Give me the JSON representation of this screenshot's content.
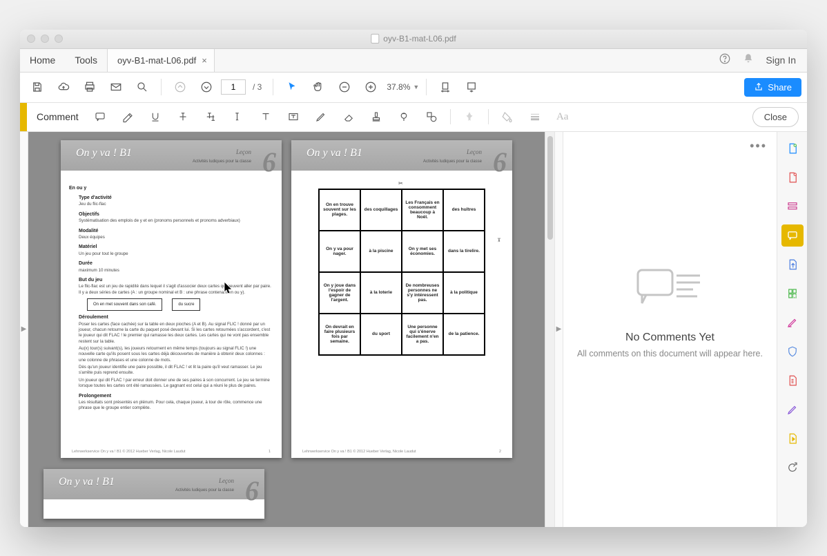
{
  "window": {
    "title": "oyv-B1-mat-L06.pdf"
  },
  "tabs": {
    "home": "Home",
    "tools": "Tools",
    "doc": "oyv-B1-mat-L06.pdf"
  },
  "header": {
    "signin": "Sign In"
  },
  "toolbar": {
    "page_current": "1",
    "page_total": "/ 3",
    "zoom": "37.8%",
    "share": "Share"
  },
  "commentbar": {
    "label": "Comment",
    "close": "Close"
  },
  "comments_panel": {
    "title": "No Comments Yet",
    "sub": "All comments on this document will appear here."
  },
  "doc": {
    "book_title": "On y va ! B1",
    "lecon": "Leçon",
    "activites": "Activités ludiques pour la classe",
    "lesson_num": "6",
    "footer_left": "Lehrwerkservice On y va ! B1 © 2012 Hueber Verlag, Nicole Laudut",
    "footer_p1": "1",
    "footer_p2": "2",
    "page1": {
      "h1": "En ou y",
      "type_h": "Type d'activité",
      "type_p": "Jeu du flic-flac",
      "obj_h": "Objectifs",
      "obj_p": "Systématisation des emplois de y et en (pronoms personnels et pronoms adverbiaux)",
      "mod_h": "Modalité",
      "mod_p": "Deux équipes",
      "mat_h": "Matériel",
      "mat_p": "Un jeu pour tout le groupe",
      "dur_h": "Durée",
      "dur_p": "maximum 10 minutes",
      "but_h": "But du jeu",
      "but_p": "Le flic-flac est un jeu de rapidité dans lequel il s'agit d'associer deux cartes qui peuvent aller par paire. Il y a deux séries de cartes (A : un groupe nominal et B : une phrase contenant en ou y).",
      "box1": "On en met souvent dans son café.",
      "box2": "du sucre",
      "der_h": "Déroulement",
      "der_p1": "Poser les cartes (face cachée) sur la table en deux pioches (A et B). Au signal FLIC ! donné par un joueur, chacun retourne la carte du paquet posé devant lui. Si les cartes retournées s'accordent, c'est le joueur qui dit FLAC ! le premier qui ramasse les deux cartes. Les cartes qui ne vont pas ensemble restent sur la table.",
      "der_p2": "Au(x) tour(s) suivant(s), les joueurs retournent en même temps (toujours au signal FLIC !) une nouvelle carte qu'ils posent sous les cartes déjà découvertes de manière à obtenir deux colonnes : une colonne de phrases et une colonne de mots.",
      "der_p3": "Dès qu'un joueur identifie une paire possible, il dit FLAC ! et lit la paire qu'il veut ramasser. Le jeu s'arrête puis reprend ensuite.",
      "der_p4": "Un joueur qui dit FLAC ! par erreur doit donner une de ses paires à son concurrent. Le jeu se termine lorsque toutes les cartes ont été ramassées. Le gagnant est celui qui a réuni le plus de paires.",
      "pro_h": "Prolongement",
      "pro_p": "Les résultats sont présentés en plénum. Pour cela, chaque joueur, à tour de rôle, commence une phrase que le groupe entier complète."
    },
    "page2_grid": [
      [
        "On en trouve souvent sur les plages.",
        "des coquillages",
        "Les Français en consomment beaucoup à Noël.",
        "des huîtres"
      ],
      [
        "On y va pour nager.",
        "à la piscine",
        "On y met ses économies.",
        "dans la tirelire."
      ],
      [
        "On y joue dans l'espoir de gagner de l'argent.",
        "à la loterie",
        "De nombreuses personnes ne s'y intéressent pas.",
        "à la politique"
      ],
      [
        "On devrait en faire plusieurs fois par semaine.",
        "du sport",
        "Une personne qui s'énerve facilement n'en a pas.",
        "de la patience."
      ]
    ]
  },
  "colors": {
    "accent": "#e6b800",
    "share": "#1a8cff"
  }
}
